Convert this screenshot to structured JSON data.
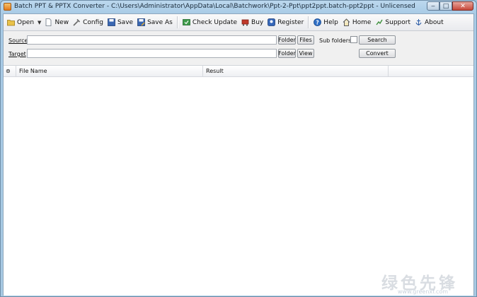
{
  "window": {
    "title": "Batch PPT & PPTX Converter - C:\\Users\\Administrator\\AppData\\Local\\Batchwork\\Ppt-2-Ppt\\ppt2ppt.batch-ppt2ppt - Unlicensed",
    "minimize": "‒",
    "maximize": "□",
    "close": "✕"
  },
  "toolbar": {
    "open": "Open",
    "new": "New",
    "config": "Config",
    "save": "Save",
    "save_as": "Save As",
    "check_update": "Check Update",
    "buy": "Buy",
    "register": "Register",
    "help": "Help",
    "home": "Home",
    "support": "Support",
    "about": "About"
  },
  "form": {
    "source_label": "Source",
    "source_value": "",
    "target_label": "Target",
    "target_value": "",
    "source_folder": "Folder",
    "source_files": "Files",
    "subfolders_label": "Sub folders",
    "subfolders_checked": false,
    "search": "Search",
    "target_folder": "Folder",
    "target_view": "View",
    "convert": "Convert"
  },
  "list": {
    "columns": [
      "File Name",
      "Result"
    ],
    "rows": []
  },
  "watermark": {
    "text": "绿色先锋",
    "url": "www.greenxf.com"
  }
}
